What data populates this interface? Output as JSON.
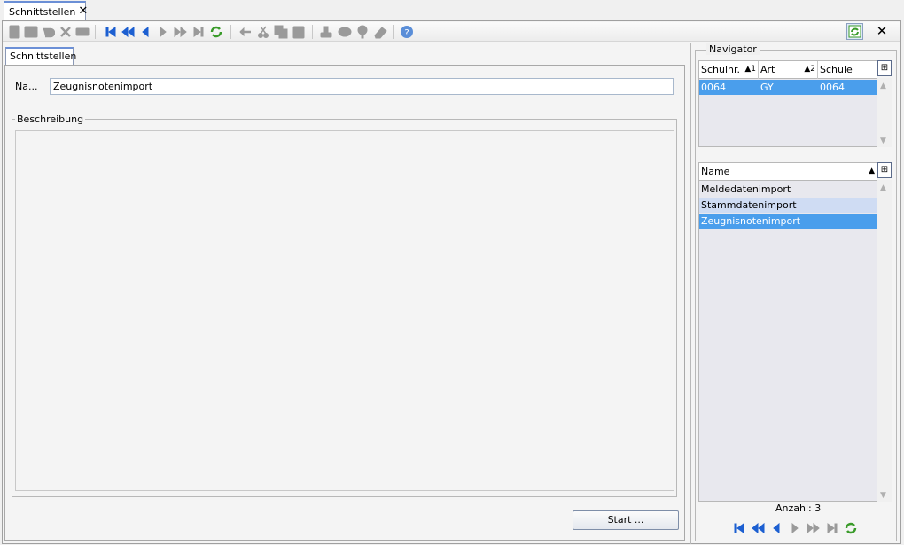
{
  "doc_tab": {
    "label": "Schnittstellen",
    "close_glyph": "✕"
  },
  "toolbar": {
    "icons": [
      "new-icon",
      "save-icon",
      "undo-icon",
      "delete-icon",
      "print-icon",
      "first-icon",
      "prev-page-icon",
      "prev-icon",
      "next-icon",
      "next-page-icon",
      "last-icon",
      "refresh-icon",
      "back-icon",
      "cut-icon",
      "copy-icon",
      "paste-icon",
      "stamp-icon",
      "disk-icon",
      "pin-icon",
      "eraser-icon",
      "help-icon"
    ],
    "close_glyph": "✕"
  },
  "form": {
    "tab_label": "Schnittstellen",
    "name_label": "Na...",
    "name_value": "Zeugnisnotenimport",
    "description_label": "Beschreibung",
    "start_button": "Start ..."
  },
  "navigator": {
    "title": "Navigator",
    "table1": {
      "columns": [
        {
          "label": "Schulnr.",
          "sort": "▲1"
        },
        {
          "label": "Art",
          "sort": "▲2"
        },
        {
          "label": "Schule",
          "sort": ""
        }
      ],
      "rows": [
        [
          "0064",
          "GY",
          "0064"
        ]
      ]
    },
    "table2": {
      "columns": [
        {
          "label": "Name",
          "sort": "▲"
        }
      ],
      "rows": [
        "Meldedatenimport",
        "Stammdatenimport",
        "Zeugnisnotenimport"
      ]
    },
    "count": "Anzahl: 3"
  },
  "colors": {
    "selection": "#4a9eec",
    "row_alt": "#cfdcf3",
    "accent": "#1c5fd1"
  }
}
